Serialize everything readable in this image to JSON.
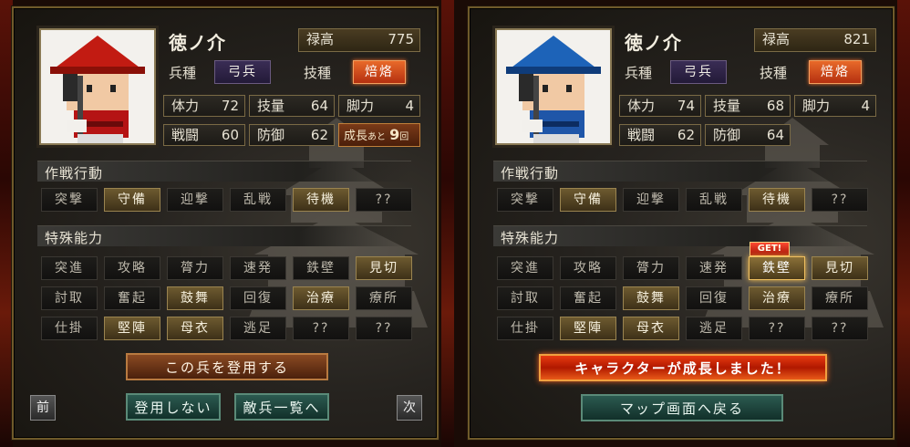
{
  "colors": {
    "highlight_on": "#6d5a30",
    "accent_orange": "#e86a2a",
    "get_red": "#ff4a30"
  },
  "left": {
    "name": "徳ノ介",
    "rokudaka_label": "禄高",
    "rokudaka": "775",
    "heishu_label": "兵種",
    "heishu": "弓兵",
    "gihou_label": "技種",
    "gihou": "焙烙",
    "stats": {
      "tairyoku_label": "体力",
      "tairyoku": "72",
      "giryou_label": "技量",
      "giryou": "64",
      "kyakuryoku_label": "脚力",
      "kyakuryoku": "4",
      "sentou_label": "戦闘",
      "sentou": "60",
      "bougyo_label": "防御",
      "bougyo": "62"
    },
    "growth": {
      "prefix": "成長",
      "mid": "あと",
      "num": "9",
      "suffix": "回"
    },
    "tactics_title": "作戦行動",
    "tactics": [
      "突撃",
      "守備",
      "迎撃",
      "乱戦",
      "待機",
      "??"
    ],
    "abilities_title": "特殊能力",
    "abilities": [
      "突進",
      "攻略",
      "膂力",
      "速発",
      "鉄壁",
      "見切",
      "討取",
      "奮起",
      "鼓舞",
      "回復",
      "治療",
      "療所",
      "仕掛",
      "堅陣",
      "母衣",
      "逃足",
      "??",
      "??"
    ],
    "recruit_button": "この兵を登用する",
    "no_recruit_button": "登用しない",
    "enemy_list_button": "敵兵一覧へ",
    "prev_button": "前",
    "next_button": "次"
  },
  "right": {
    "name": "徳ノ介",
    "rokudaka_label": "禄高",
    "rokudaka": "821",
    "heishu_label": "兵種",
    "heishu": "弓兵",
    "gihou_label": "技種",
    "gihou": "焙烙",
    "stats": {
      "tairyoku_label": "体力",
      "tairyoku": "74",
      "giryou_label": "技量",
      "giryou": "68",
      "kyakuryoku_label": "脚力",
      "kyakuryoku": "4",
      "sentou_label": "戦闘",
      "sentou": "62",
      "bougyo_label": "防御",
      "bougyo": "64"
    },
    "tactics_title": "作戦行動",
    "tactics": [
      "突撃",
      "守備",
      "迎撃",
      "乱戦",
      "待機",
      "??"
    ],
    "abilities_title": "特殊能力",
    "abilities": [
      "突進",
      "攻略",
      "膂力",
      "速発",
      "鉄壁",
      "見切",
      "討取",
      "奮起",
      "鼓舞",
      "回復",
      "治療",
      "療所",
      "仕掛",
      "堅陣",
      "母衣",
      "逃足",
      "??",
      "??"
    ],
    "get_badge": "GET!",
    "grown_banner": "キャラクターが成長しました！",
    "map_button": "マップ画面へ戻る"
  }
}
